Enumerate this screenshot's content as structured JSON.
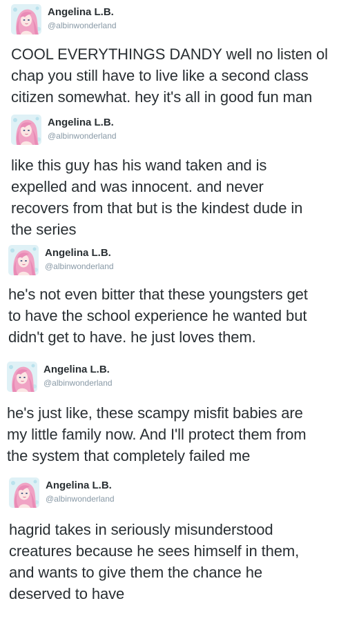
{
  "tweets": [
    {
      "author": {
        "name": "Angelina L.B.",
        "handle": "@albinwonderland",
        "avatar_icon": "avatar-image"
      },
      "lines": [
        "COOL EVERYTHINGS DANDY well no listen ol",
        "chap you still have to live like a second class",
        "citizen somewhat. hey it's all in good fun man"
      ]
    },
    {
      "author": {
        "name": "Angelina L.B.",
        "handle": "@albinwonderland",
        "avatar_icon": "avatar-image"
      },
      "lines": [
        "like this guy has his wand taken and is",
        "expelled and was innocent. and never",
        "recovers from that but is the kindest dude in",
        "the series"
      ]
    },
    {
      "author": {
        "name": "Angelina L.B.",
        "handle": "@albinwonderland",
        "avatar_icon": "avatar-image"
      },
      "lines": [
        "he's not even bitter that these youngsters get",
        "to have the school experience he wanted but",
        "didn't get to have. he just loves them."
      ]
    },
    {
      "author": {
        "name": "Angelina L.B.",
        "handle": "@albinwonderland",
        "avatar_icon": "avatar-image"
      },
      "lines": [
        "he's just like, these scampy misfit babies are",
        "my little family now. And I'll protect them from",
        "the system that completely failed me"
      ]
    },
    {
      "author": {
        "name": "Angelina L.B.",
        "handle": "@albinwonderland",
        "avatar_icon": "avatar-image"
      },
      "lines": [
        "hagrid takes in seriously misunderstood",
        "creatures because he sees himself in them,",
        "and wants to give them the chance he",
        "deserved to have"
      ]
    }
  ],
  "colors": {
    "text": "#292f33",
    "handle": "#8899a6",
    "avatar_hair": "#f0a3c4",
    "avatar_bg": "#dff1f6"
  }
}
